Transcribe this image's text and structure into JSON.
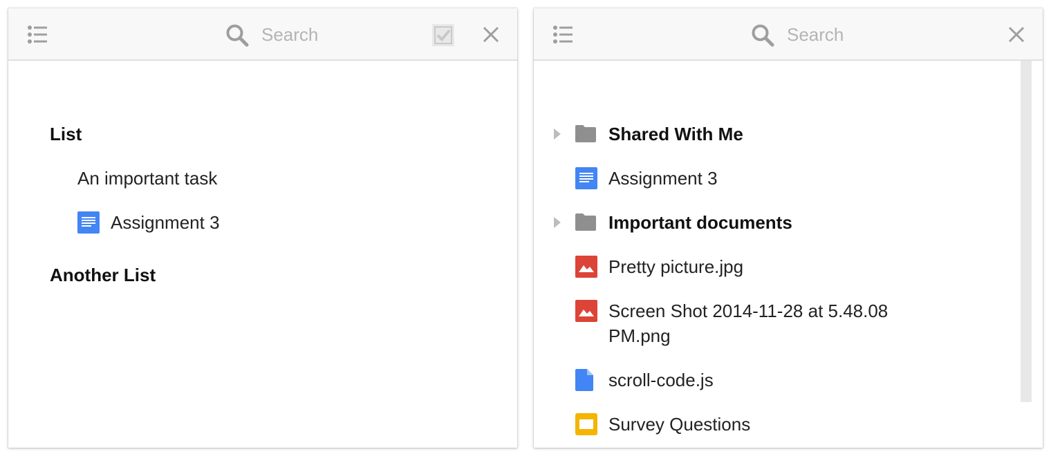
{
  "left_panel": {
    "search": {
      "placeholder": "Search"
    },
    "lists": [
      {
        "title": "List",
        "items": [
          {
            "label": "An important task",
            "icon": "none"
          },
          {
            "label": "Assignment 3",
            "icon": "google-doc-icon"
          }
        ]
      },
      {
        "title": "Another List",
        "items": []
      }
    ]
  },
  "right_panel": {
    "search": {
      "placeholder": "Search"
    },
    "items": [
      {
        "label": "Shared With Me",
        "type": "folder",
        "bold": true
      },
      {
        "label": "Assignment 3",
        "type": "google-doc"
      },
      {
        "label": "Important documents",
        "type": "folder",
        "bold": true
      },
      {
        "label": "Pretty picture.jpg",
        "type": "image"
      },
      {
        "label": "Screen Shot 2014-11-28 at 5.48.08 PM.png",
        "type": "image"
      },
      {
        "label": "scroll-code.js",
        "type": "file"
      },
      {
        "label": "Survey Questions",
        "type": "slides"
      }
    ]
  },
  "colors": {
    "doc_blue": "#4285f4",
    "image_red": "#db4437",
    "slides_yellow": "#f4b400",
    "folder_gray": "#8f8f8f",
    "icon_gray": "#9e9e9e",
    "header_bg": "#f8f8f8"
  }
}
